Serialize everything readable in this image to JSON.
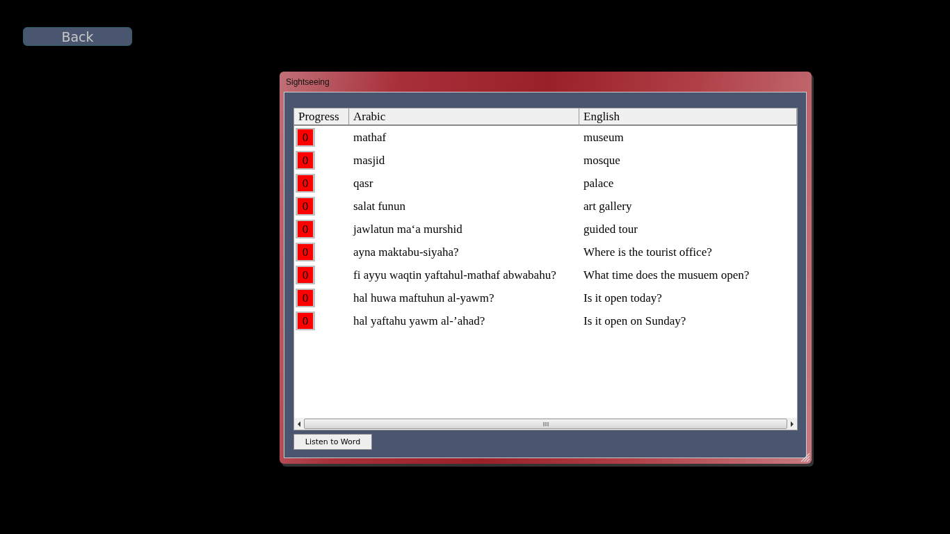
{
  "back_button": {
    "label": "Back"
  },
  "window": {
    "title": "Sightseeing"
  },
  "table": {
    "columns": [
      "Progress",
      "Arabic",
      "English"
    ],
    "rows": [
      {
        "progress": "0",
        "arabic": "mathaf",
        "english": "museum"
      },
      {
        "progress": "0",
        "arabic": "masjid",
        "english": "mosque"
      },
      {
        "progress": "0",
        "arabic": "qasr",
        "english": "palace"
      },
      {
        "progress": "0",
        "arabic": "salat funun",
        "english": "art gallery"
      },
      {
        "progress": "0",
        "arabic": "jawlatun ma‘a murshid",
        "english": "guided tour"
      },
      {
        "progress": "0",
        "arabic": "ayna maktabu-siyaha?",
        "english": "Where is the tourist office?"
      },
      {
        "progress": "0",
        "arabic": "fi ayyu waqtin yaftahul-mathaf abwabahu?",
        "english": "What time does the musuem open?"
      },
      {
        "progress": "0",
        "arabic": "hal huwa maftuhun al-yawm?",
        "english": "Is it open today?"
      },
      {
        "progress": "0",
        "arabic": "hal yaftahu yawm al-’ahad?",
        "english": "Is it open on Sunday?"
      }
    ]
  },
  "buttons": [
    "Listen to Word"
  ]
}
